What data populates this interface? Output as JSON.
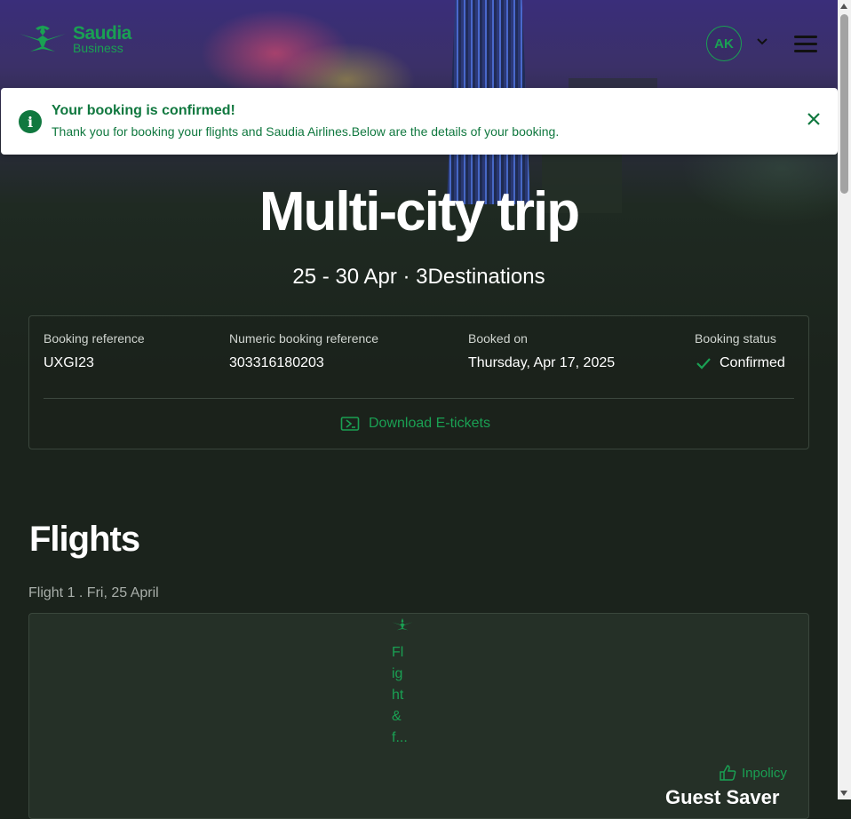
{
  "brand": {
    "name": "Saudia",
    "sub": "Business"
  },
  "header": {
    "avatar_initials": "AK"
  },
  "toast": {
    "title": "Your booking is confirmed!",
    "message": "Thank you for booking your flights and Saudia Airlines.Below are the details of your booking."
  },
  "trip": {
    "title": "Multi-city trip",
    "subtitle": "25 - 30 Apr · 3Destinations"
  },
  "booking": {
    "reference_label": "Booking reference",
    "reference": "UXGI23",
    "numeric_label": "Numeric booking reference",
    "numeric": "303316180203",
    "booked_on_label": "Booked on",
    "booked_on": "Thursday, Apr 17, 2025",
    "status_label": "Booking status",
    "status": "Confirmed",
    "download_label": "Download E-tickets"
  },
  "flights": {
    "heading": "Flights",
    "items": [
      {
        "label": "Flight 1 . Fri, 25 April",
        "vertical_text": "Flight & f...",
        "policy_label": "Inpolicy",
        "fare_name": "Guest Saver"
      }
    ]
  },
  "colors": {
    "brand_green": "#1aa053",
    "toast_green": "#10783f",
    "background": "#1b231c"
  }
}
